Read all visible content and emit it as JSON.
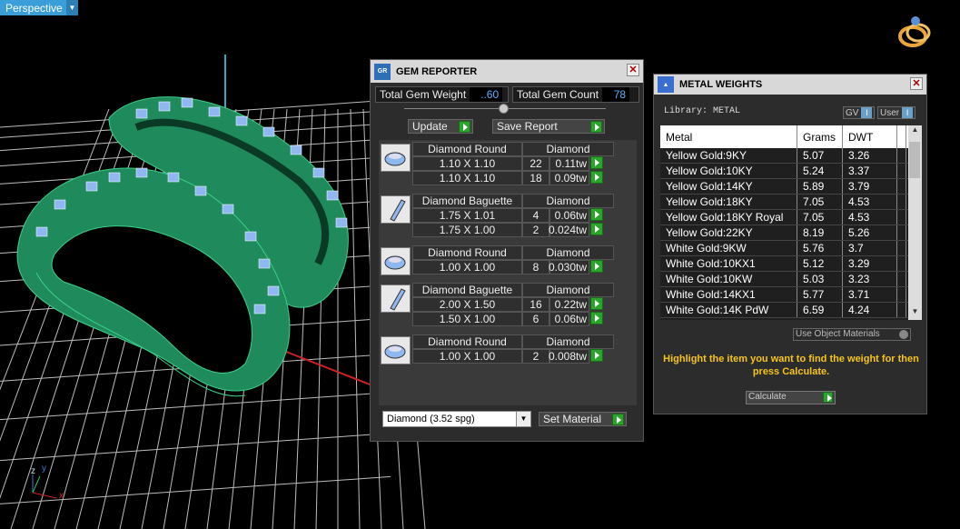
{
  "viewport": {
    "label": "Perspective",
    "axis_labels": [
      "z",
      "y",
      "x"
    ]
  },
  "gem_reporter": {
    "title": "GEM REPORTER",
    "total_weight_label": "Total Gem Weight",
    "total_weight_value": "..60",
    "total_count_label": "Total Gem Count",
    "total_count_value": "78",
    "update_label": "Update",
    "save_report_label": "Save Report",
    "groups": [
      {
        "icon": "round-gem-icon",
        "shape": "Diamond Round",
        "material": "Diamond",
        "rows": [
          {
            "size": "1.10 X 1.10",
            "qty": "22",
            "weight": "0.11tw"
          },
          {
            "size": "1.10 X 1.10",
            "qty": "18",
            "weight": "0.09tw"
          }
        ]
      },
      {
        "icon": "baguette-gem-icon",
        "shape": "Diamond Baguette",
        "material": "Diamond",
        "rows": [
          {
            "size": "1.75 X 1.01",
            "qty": "4",
            "weight": "0.06tw"
          },
          {
            "size": "1.75 X 1.00",
            "qty": "2",
            "weight": "0.024tw"
          }
        ]
      },
      {
        "icon": "round-gem-icon",
        "shape": "Diamond Round",
        "material": "Diamond",
        "rows": [
          {
            "size": "1.00 X 1.00",
            "qty": "8",
            "weight": "0.030tw"
          }
        ]
      },
      {
        "icon": "baguette-gem-icon",
        "shape": "Diamond Baguette",
        "material": "Diamond",
        "rows": [
          {
            "size": "2.00 X 1.50",
            "qty": "16",
            "weight": "0.22tw"
          },
          {
            "size": "1.50 X 1.00",
            "qty": "6",
            "weight": "0.06tw"
          }
        ]
      },
      {
        "icon": "round-gem-icon",
        "shape": "Diamond Round",
        "material": "Diamond",
        "rows": [
          {
            "size": "1.00 X 1.00",
            "qty": "2",
            "weight": "0.008tw"
          }
        ]
      }
    ],
    "material_select": "Diamond     (3.52 spg)",
    "set_material_label": "Set Material"
  },
  "metal_weights": {
    "title": "METAL WEIGHTS",
    "library_label": "Library: METAL",
    "gv_label": "GV",
    "user_label": "User",
    "columns": [
      "Metal",
      "Grams",
      "DWT"
    ],
    "rows": [
      [
        "Yellow Gold:9KY",
        "5.07",
        "3.26"
      ],
      [
        "Yellow Gold:10KY",
        "5.24",
        "3.37"
      ],
      [
        "Yellow Gold:14KY",
        "5.89",
        "3.79"
      ],
      [
        "Yellow Gold:18KY",
        "7.05",
        "4.53"
      ],
      [
        "Yellow Gold:18KY Royal",
        "7.05",
        "4.53"
      ],
      [
        "Yellow Gold:22KY",
        "8.19",
        "5.26"
      ],
      [
        "White Gold:9KW",
        "5.76",
        "3.7"
      ],
      [
        "White Gold:10KX1",
        "5.12",
        "3.29"
      ],
      [
        "White Gold:10KW",
        "5.03",
        "3.23"
      ],
      [
        "White Gold:14KX1",
        "5.77",
        "3.71"
      ],
      [
        "White Gold:14K PdW",
        "6.59",
        "4.24"
      ]
    ],
    "use_object_materials": "Use Object Materials",
    "hint": "Highlight the item you want to find the weight for then press Calculate.",
    "calculate_label": "Calculate"
  },
  "colors": {
    "wireframe": "#2f9f6f",
    "gem_blue": "#8fb8f0",
    "grid": "#bcbcbc",
    "hint_yellow": "#f5c518"
  }
}
